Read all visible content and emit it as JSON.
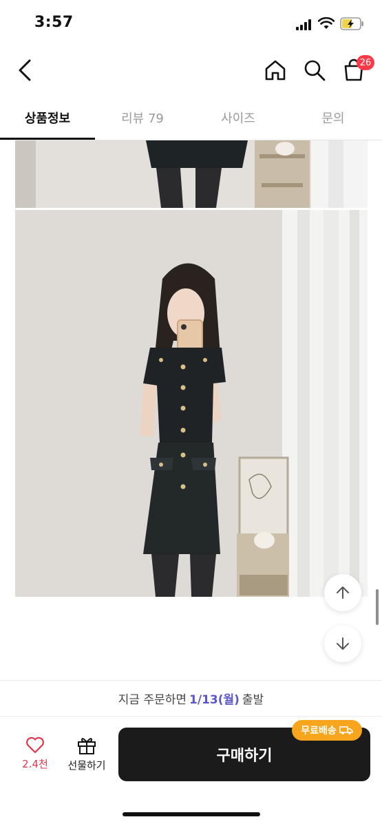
{
  "status_bar": {
    "time": "3:57"
  },
  "header": {
    "cart_count": "26"
  },
  "tabs": [
    {
      "label": "상품정보"
    },
    {
      "label": "리뷰 79"
    },
    {
      "label": "사이즈"
    },
    {
      "label": "문의"
    }
  ],
  "delivery": {
    "prefix": "지금 주문하면",
    "date": "1/13(월)",
    "suffix": "출발"
  },
  "action_bar": {
    "like_count": "2.4천",
    "gift_label": "선물하기",
    "buy_label": "구매하기",
    "free_shipping_label": "무료배송"
  },
  "colors": {
    "accent": "#5b57c9",
    "like": "#e2374a",
    "badge": "#ff3b4a",
    "free_shipping": "#f7a51d",
    "buy_button": "#1b1b1b"
  }
}
